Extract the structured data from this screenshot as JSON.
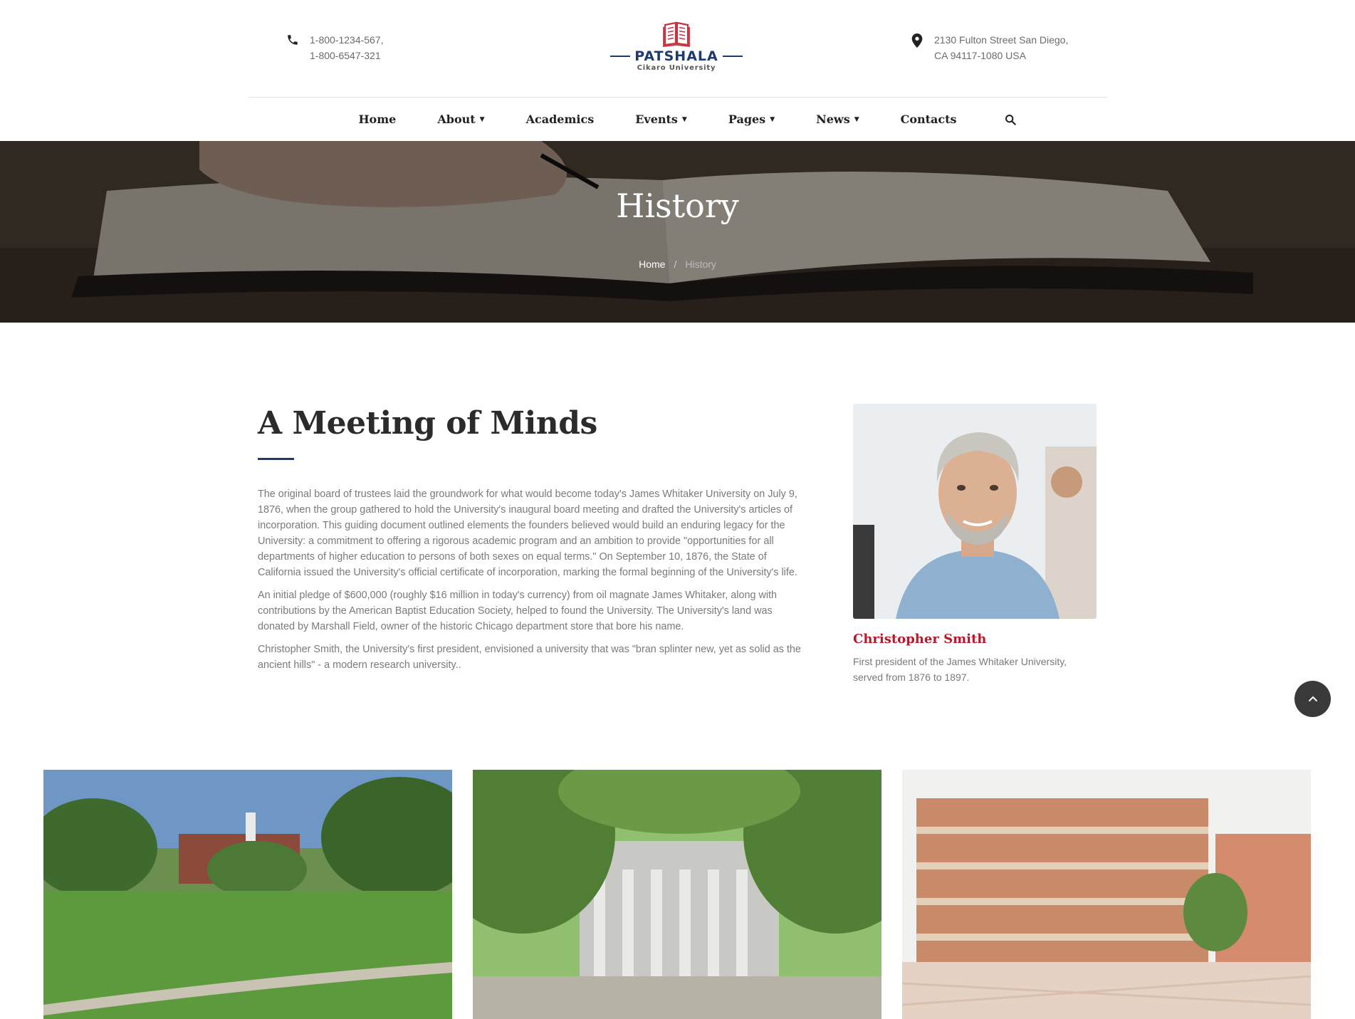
{
  "header": {
    "phone_lines": [
      "1-800-1234-567,",
      "1-800-6547-321"
    ],
    "address_lines": [
      "2130 Fulton Street San Diego,",
      "CA 94117-1080 USA"
    ],
    "logo": {
      "brand": "PATSHALA",
      "subtitle": "Cikaro University"
    }
  },
  "nav": {
    "items": [
      {
        "label": "Home",
        "has_dropdown": false
      },
      {
        "label": "About",
        "has_dropdown": true
      },
      {
        "label": "Academics",
        "has_dropdown": false
      },
      {
        "label": "Events",
        "has_dropdown": true
      },
      {
        "label": "Pages",
        "has_dropdown": true
      },
      {
        "label": "News",
        "has_dropdown": true
      },
      {
        "label": "Contacts",
        "has_dropdown": false
      }
    ],
    "search_icon": "search-icon"
  },
  "hero": {
    "title": "History",
    "breadcrumb": {
      "home": "Home",
      "separator": "/",
      "current": "History"
    }
  },
  "article": {
    "heading": "A Meeting of Minds",
    "paragraphs": [
      "The original board of trustees laid the groundwork for what would become today's James Whitaker University on July 9, 1876, when the group gathered to hold the University's inaugural board meeting and drafted the University's articles of incorporation. This guiding document outlined elements the founders believed would build an enduring legacy for the University: a commitment to offering a rigorous academic program and an ambition to provide \"opportunities for all departments of higher education to persons of both sexes on equal terms.\" On September 10, 1876, the State of California issued the University's official certificate of incorporation, marking the formal beginning of the University's life.",
      "An initial pledge of $600,000 (roughly $16 million in today's currency) from oil magnate James Whitaker, along with contributions by the American Baptist Education Society, helped to found the University. The University's land was donated by Marshall Field, owner of the historic Chicago department store that bore his name.",
      "Christopher Smith, the University's first president, envisioned a university that was \"bran splinter new, yet as solid as the ancient hills\" - a modern research university.."
    ]
  },
  "profile": {
    "name": "Christopher Smith",
    "role": "First president of the James Whitaker University, served from 1876 to 1897."
  },
  "colors": {
    "accent_navy": "#1e3a6e",
    "accent_red": "#b41a2b",
    "text_dark": "#2b2b2b",
    "text_muted": "#7a7a7a"
  }
}
